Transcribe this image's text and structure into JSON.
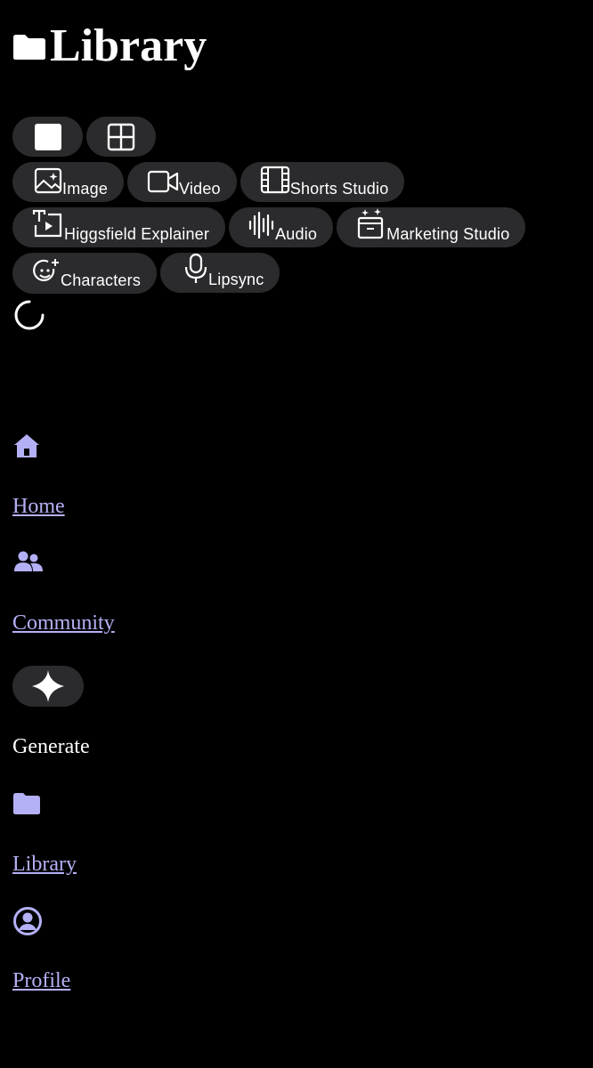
{
  "header": {
    "title": "Library",
    "icon": "folder-icon"
  },
  "view_toggle": [
    {
      "icon": "square-view-icon"
    },
    {
      "icon": "grid-view-icon"
    }
  ],
  "filters": {
    "image": "Image",
    "video": "Video",
    "shorts_studio": "Shorts Studio",
    "higgsfield_explainer": "Higgsfield Explainer",
    "audio": "Audio",
    "marketing_studio": "Marketing Studio",
    "characters": "Characters",
    "lipsync": "Lipsync"
  },
  "nav": {
    "home": "Home",
    "community": "Community",
    "generate": "Generate",
    "library": "Library",
    "profile": "Profile"
  },
  "colors": {
    "background": "#000000",
    "pill": "#2b2b2e",
    "accent": "#b4b0f5",
    "text": "#ffffff"
  }
}
